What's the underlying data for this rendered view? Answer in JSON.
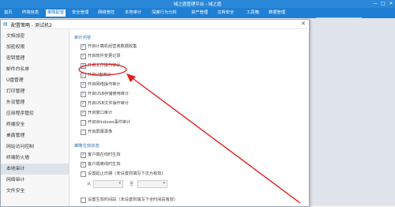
{
  "titlebar": {
    "title": "域之盾管理平台 - 域之盾",
    "minimize": "—",
    "maximize": "□",
    "close": "✕"
  },
  "menu": {
    "items": [
      {
        "label": "首页"
      },
      {
        "label": "终端信息"
      },
      {
        "label": "策略配置"
      },
      {
        "label": "安全管理"
      },
      {
        "label": "网络管控"
      },
      {
        "label": "本地审计"
      },
      {
        "label": "深度行为分析"
      },
      {
        "label": "资产管理"
      },
      {
        "label": "文档安全"
      },
      {
        "label": "工具箱"
      },
      {
        "label": "数据管理"
      }
    ],
    "active_index": 2,
    "search_placeholder": "请输入终端名称",
    "user": "admin"
  },
  "dialog": {
    "title": "配置策略 - 测试机2",
    "nav": [
      {
        "label": "文档加密"
      },
      {
        "label": "加密权限"
      },
      {
        "label": "密钥管理"
      },
      {
        "label": "邮件白名单"
      },
      {
        "label": "U盘管理"
      },
      {
        "label": "打印管理"
      },
      {
        "label": "外设管理"
      },
      {
        "label": "应用程序管控"
      },
      {
        "label": "终端安全"
      },
      {
        "label": "桌面管理"
      },
      {
        "label": "网站访问控制"
      },
      {
        "label": "终端防火墙"
      },
      {
        "label": "本地审计"
      },
      {
        "label": "网络审计"
      },
      {
        "label": "文件安全"
      }
    ],
    "nav_active_index": 12,
    "section1": "审计内容",
    "options": [
      {
        "label": "开启计算机经营商数据收集",
        "checked": true
      },
      {
        "label": "开启软件变更记录",
        "checked": true
      },
      {
        "label": "开启文件操作审计",
        "checked": true
      },
      {
        "label": "开启U盘审计",
        "checked": true
      },
      {
        "label": "开启网络操作审计",
        "checked": true
      },
      {
        "label": "开启USB存储使用审计",
        "checked": true
      },
      {
        "label": "开启USB文件操作审计",
        "checked": true
      },
      {
        "label": "开启窗口审计",
        "checked": true
      },
      {
        "label": "开启Windows事件审计",
        "checked": false
      },
      {
        "label": "开启屏幕录像",
        "checked": false
      }
    ],
    "section2": "策略生效状态",
    "options2": [
      {
        "label": "客户端在线时生效",
        "checked": true
      },
      {
        "label": "客户端离线时生效",
        "checked": true
      },
      {
        "label": "设置起止日期（未设置则填写下次为有效）",
        "checked": false
      }
    ],
    "date_from_label": "从",
    "date_to_label": "至",
    "last_option": "设置生效时间段（未设置则填写下全时间段有效）"
  }
}
